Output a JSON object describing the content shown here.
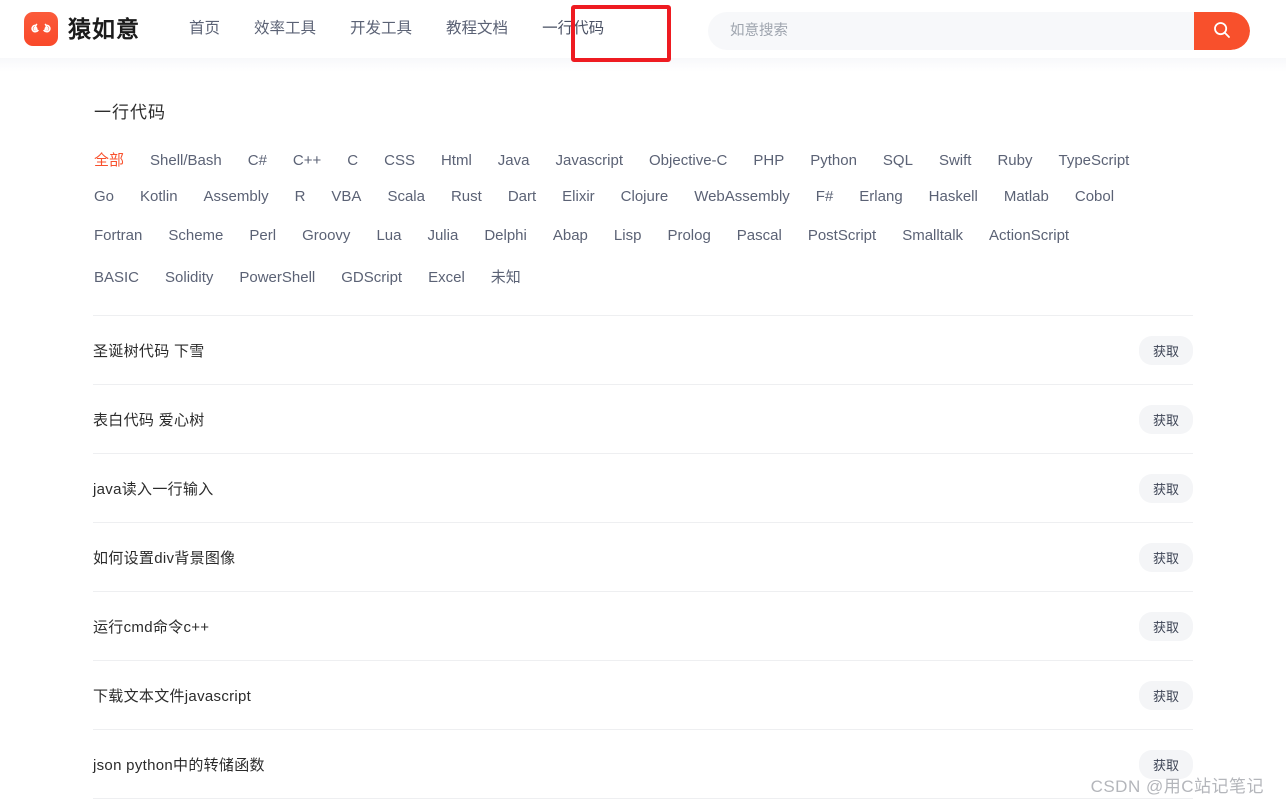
{
  "header": {
    "logo_icon": "monkey-spiral-logo-icon",
    "brand_name": "猿如意",
    "nav": [
      {
        "label": "首页",
        "active": false
      },
      {
        "label": "效率工具",
        "active": false
      },
      {
        "label": "开发工具",
        "active": false
      },
      {
        "label": "教程文档",
        "active": false
      },
      {
        "label": "一行代码",
        "active": true
      }
    ],
    "search": {
      "placeholder": "如意搜索",
      "value": "",
      "button_icon": "search-icon"
    },
    "annotation_color": "#ee1b21"
  },
  "main": {
    "page_title": "一行代码",
    "accent_color": "#f8502c",
    "tag_rows": [
      [
        "全部",
        "Shell/Bash",
        "C#",
        "C++",
        "C",
        "CSS",
        "Html",
        "Java",
        "Javascript",
        "Objective-C",
        "PHP",
        "Python",
        "SQL",
        "Swift",
        "Ruby",
        "TypeScript"
      ],
      [
        "Go",
        "Kotlin",
        "Assembly",
        "R",
        "VBA",
        "Scala",
        "Rust",
        "Dart",
        "Elixir",
        "Clojure",
        "WebAssembly",
        "F#",
        "Erlang",
        "Haskell",
        "Matlab",
        "Cobol"
      ],
      [
        "Fortran",
        "Scheme",
        "Perl",
        "Groovy",
        "Lua",
        "Julia",
        "Delphi",
        "Abap",
        "Lisp",
        "Prolog",
        "Pascal",
        "PostScript",
        "Smalltalk",
        "ActionScript"
      ],
      [
        "BASIC",
        "Solidity",
        "PowerShell",
        "GDScript",
        "Excel",
        "未知"
      ]
    ],
    "selected_tag": "全部",
    "get_label": "获取",
    "rows": [
      {
        "title": "圣诞树代码 下雪"
      },
      {
        "title": "表白代码 爱心树"
      },
      {
        "title": "java读入一行输入"
      },
      {
        "title": "如何设置div背景图像"
      },
      {
        "title": "运行cmd命令c++"
      },
      {
        "title": "下载文本文件javascript"
      },
      {
        "title": "json python中的转储函数"
      }
    ]
  },
  "watermark": "CSDN @用C站记笔记"
}
